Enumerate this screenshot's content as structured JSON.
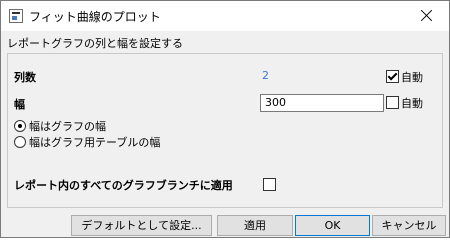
{
  "window": {
    "title": "フィット曲線のプロット"
  },
  "header": {
    "text": "レポートグラフの列と幅を設定する"
  },
  "columns": {
    "label": "列数",
    "value": "2",
    "auto_label": "自動",
    "auto_checked": true
  },
  "width": {
    "label": "幅",
    "value": "300",
    "auto_label": "自動",
    "auto_checked": false
  },
  "width_mode": {
    "options": [
      "幅はグラフの幅",
      "幅はグラフ用テーブルの幅"
    ],
    "selected": 0
  },
  "apply_all": {
    "label": "レポート内のすべてのグラフブランチに適用",
    "checked": false
  },
  "buttons": {
    "default": "デフォルトとして設定...",
    "apply": "適用",
    "ok": "OK",
    "cancel": "キャンセル"
  }
}
